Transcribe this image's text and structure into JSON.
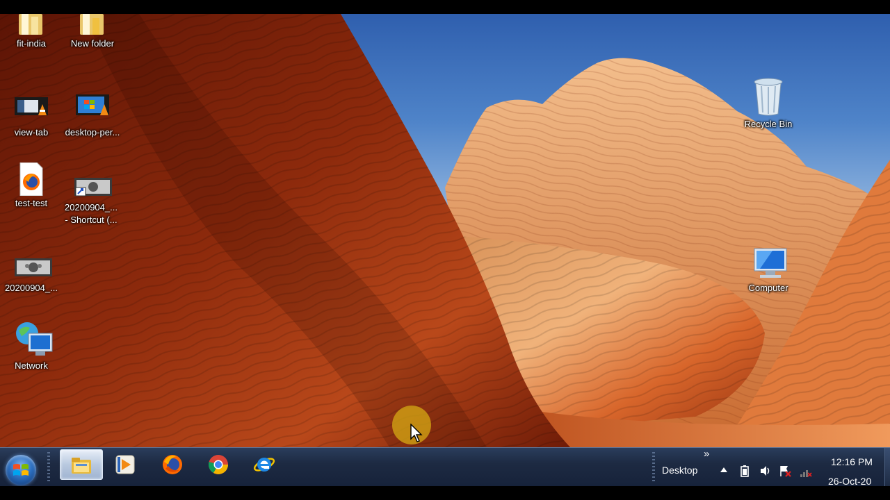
{
  "desktop": {
    "icons": [
      {
        "label": "fit-india",
        "icon": "folder-icon"
      },
      {
        "label": "New folder",
        "icon": "folder-icon"
      },
      {
        "label": "view-tab",
        "icon": "video-file-icon"
      },
      {
        "label": "desktop-per...",
        "icon": "video-file-icon"
      },
      {
        "label": "test-test",
        "icon": "firefox-document-icon"
      },
      {
        "label": "20200904_...\n- Shortcut (...",
        "icon": "shortcut-icon"
      },
      {
        "label": "20200904_...",
        "icon": "image-file-icon"
      },
      {
        "label": "Network",
        "icon": "network-icon"
      },
      {
        "label": "Recycle Bin",
        "icon": "recycle-bin-icon"
      },
      {
        "label": "Computer",
        "icon": "computer-icon"
      }
    ]
  },
  "taskbar": {
    "start_icon": "windows-logo-icon",
    "pinned": [
      {
        "icon": "file-explorer-icon",
        "active": true
      },
      {
        "icon": "media-player-icon",
        "active": false
      },
      {
        "icon": "firefox-icon",
        "active": false
      },
      {
        "icon": "chrome-icon",
        "active": false
      },
      {
        "icon": "internet-explorer-icon",
        "active": false
      }
    ],
    "toolbar": {
      "chevron": "»",
      "label": "Desktop"
    },
    "tray": {
      "time": "12:16 PM",
      "date": "26-Oct-20",
      "icons": [
        "show-hidden-icon",
        "power-icon",
        "volume-icon",
        "action-center-icon",
        "network-status-icon"
      ]
    }
  },
  "colors": {
    "taskbar": "#1d2a42",
    "sky": "#4f84c9",
    "rock_dark": "#7a1e08",
    "rock_light": "#e8894a"
  }
}
